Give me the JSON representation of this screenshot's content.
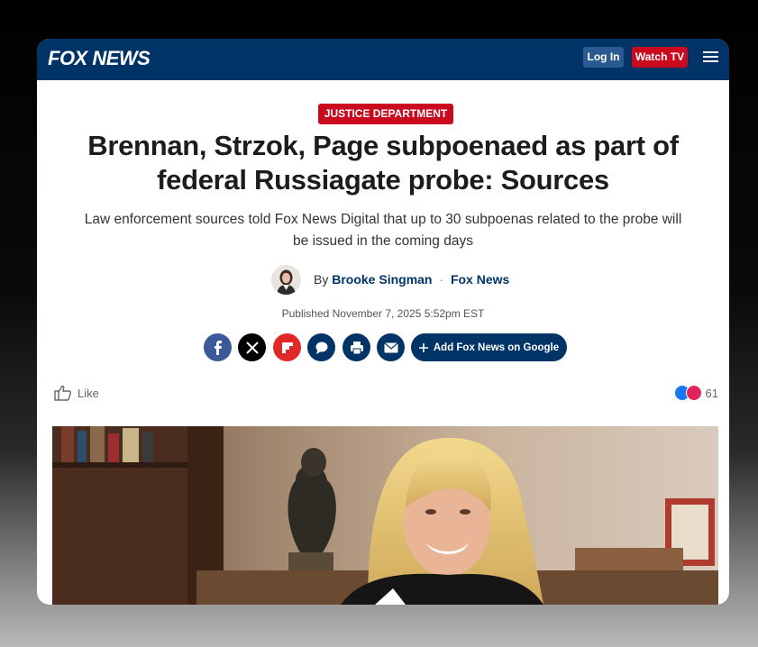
{
  "header": {
    "logo_text": "FOX NEWS",
    "login_label": "Log In",
    "watch_label": "Watch TV"
  },
  "article": {
    "tag": "JUSTICE DEPARTMENT",
    "headline_line1": "Brennan, Strzok, Page subpoenaed as part of",
    "headline_line2": "federal Russiagate probe: Sources",
    "subhead_line1": "Law enforcement sources told Fox News Digital that up to 30 subpoenas related to the probe will",
    "subhead_line2": "be issued in the coming days",
    "byline_prefix": "By",
    "author": "Brooke Singman",
    "separator": "·",
    "outlet": "Fox News",
    "published": "Published November 7, 2025 5:52pm EST"
  },
  "share": {
    "google_label": "Add Fox News on Google"
  },
  "engagement": {
    "like_label": "Like",
    "reaction_count": "61"
  },
  "colors": {
    "brand_navy": "#003366",
    "brand_red": "#cc0a1f"
  },
  "icons": [
    "facebook-icon",
    "x-icon",
    "flipboard-icon",
    "comment-icon",
    "print-icon",
    "email-icon",
    "plus-icon",
    "thumbs-up-icon",
    "menu-icon"
  ]
}
